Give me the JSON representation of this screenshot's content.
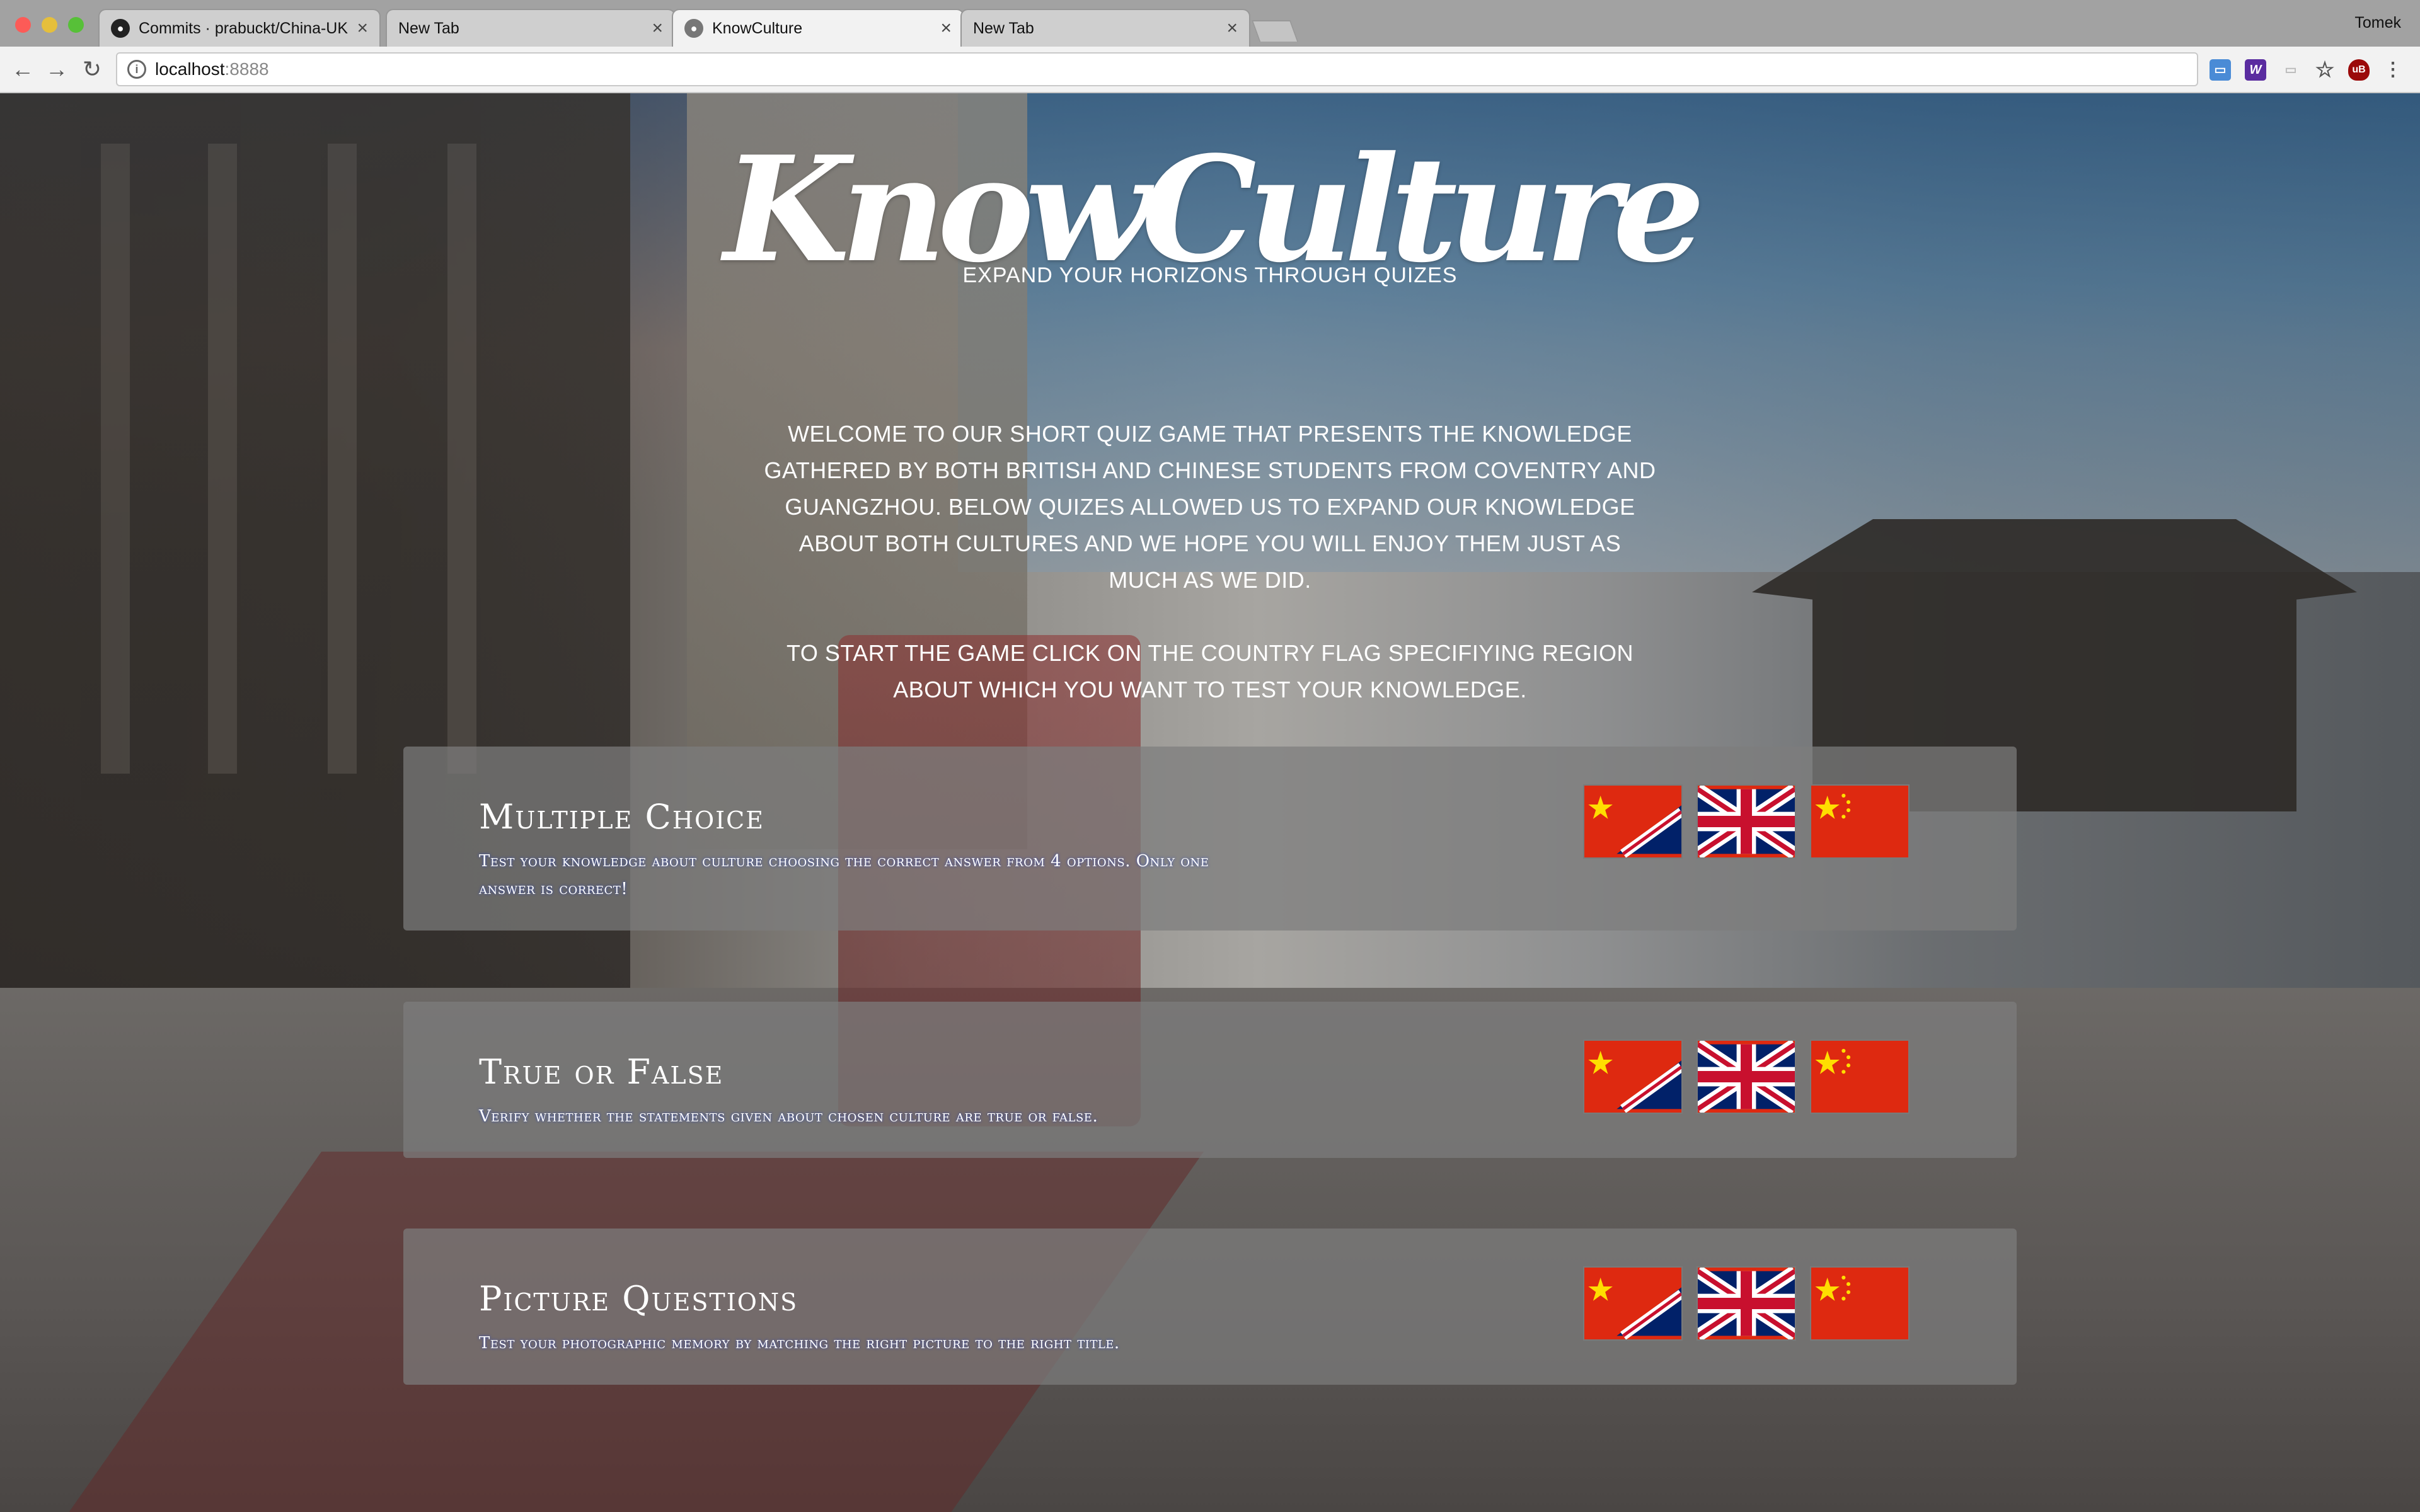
{
  "browser": {
    "tabs": [
      {
        "title": "Commits · prabuckt/China-UK",
        "icon": "github-icon",
        "active": false
      },
      {
        "title": "New Tab",
        "icon": "none",
        "active": false
      },
      {
        "title": "KnowCulture",
        "icon": "github-icon",
        "active": true
      },
      {
        "title": "New Tab",
        "icon": "none",
        "active": false
      }
    ],
    "profile_name": "Tomek",
    "url_host": "localhost",
    "url_port": ":8888",
    "extensions": [
      "window-icon",
      "w-extension-icon",
      "cast-icon",
      "bookmark-star-icon",
      "ublock-icon",
      "menu-icon"
    ]
  },
  "header": {
    "logo": "KnowCulture",
    "tagline": "EXPAND YOUR HORIZONS THROUGH QUIZES"
  },
  "intro": {
    "paragraph1": "Welcome to our short quiz game that presents the knowledge gathered by both British and Chinese students from Coventry and Guangzhou. Below quizes allowed us to expand our knowledge about both cultures and we hope you will enjoy them just as much as we did.",
    "paragraph2": "To start the game click on the country flag specifiying region about which you want to test your knowledge."
  },
  "quizzes": [
    {
      "title": "Multiple Choice",
      "description": "Test your knowledge about culture choosing the correct answer from 4 options. Only one answer is correct!",
      "flags": [
        "china-uk-flag",
        "uk-flag",
        "china-flag"
      ]
    },
    {
      "title": "True or False",
      "description": "Verify whether the statements given about chosen culture are true or false.",
      "flags": [
        "china-uk-flag",
        "uk-flag",
        "china-flag"
      ]
    },
    {
      "title": "Picture Questions",
      "description": "Test your photographic memory by matching the right picture to the right title.",
      "flags": [
        "china-uk-flag",
        "uk-flag",
        "china-flag"
      ]
    }
  ],
  "colors": {
    "china_red": "#de2910",
    "china_yellow": "#ffde00",
    "uk_blue": "#012169",
    "uk_red": "#c8102e"
  }
}
